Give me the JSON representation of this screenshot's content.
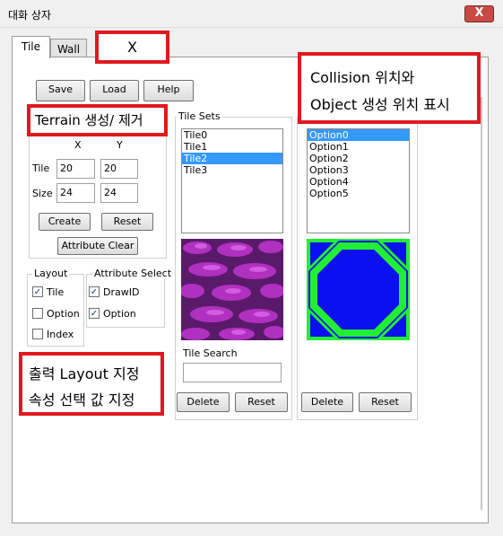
{
  "window": {
    "title": "대화 상자",
    "close_label": "X"
  },
  "tabs": [
    {
      "label": "Tile"
    },
    {
      "label": "Wall"
    }
  ],
  "toolbar": {
    "save": "Save",
    "load": "Load",
    "help": "Help"
  },
  "terrain": {
    "col_x": "X",
    "col_y": "Y",
    "tile_label": "Tile",
    "tile_x": "20",
    "tile_y": "20",
    "size_label": "Size",
    "size_x": "24",
    "size_y": "24",
    "create": "Create",
    "reset": "Reset",
    "attribute_clear": "Attribute Clear"
  },
  "layout_group": {
    "title": "Layout",
    "tile": "Tile",
    "option": "Option",
    "index": "Index",
    "tile_checked": true,
    "option_checked": false,
    "index_checked": false
  },
  "attribute_group": {
    "title": "Attribute Select",
    "drawid": "DrawID",
    "option": "Option",
    "drawid_checked": true,
    "option_checked": true
  },
  "tilesets": {
    "title": "Tile Sets",
    "items": [
      "Tile0",
      "Tile1",
      "Tile2",
      "Tile3"
    ],
    "selected_index": 2,
    "search_label": "Tile Search",
    "search_value": "",
    "delete": "Delete",
    "reset": "Reset"
  },
  "options": {
    "items": [
      "Option0",
      "Option1",
      "Option2",
      "Option3",
      "Option4",
      "Option5"
    ],
    "selected_index": 0,
    "delete": "Delete",
    "reset": "Reset"
  },
  "annotations": {
    "tab_x": "X",
    "collision_line1": "Collision 위치와",
    "collision_line2": "Object 생성 위치 표시",
    "terrain": "Terrain 생성/ 제거",
    "output_line1": "출력 Layout 지정",
    "output_line2": "속성 선택 값 지정"
  },
  "colors": {
    "annotation_border": "#e0191e",
    "selection": "#3399ff",
    "collision_blue": "#0a10f0",
    "collision_green": "#22ee33",
    "tile_purple": "#b030c0"
  }
}
